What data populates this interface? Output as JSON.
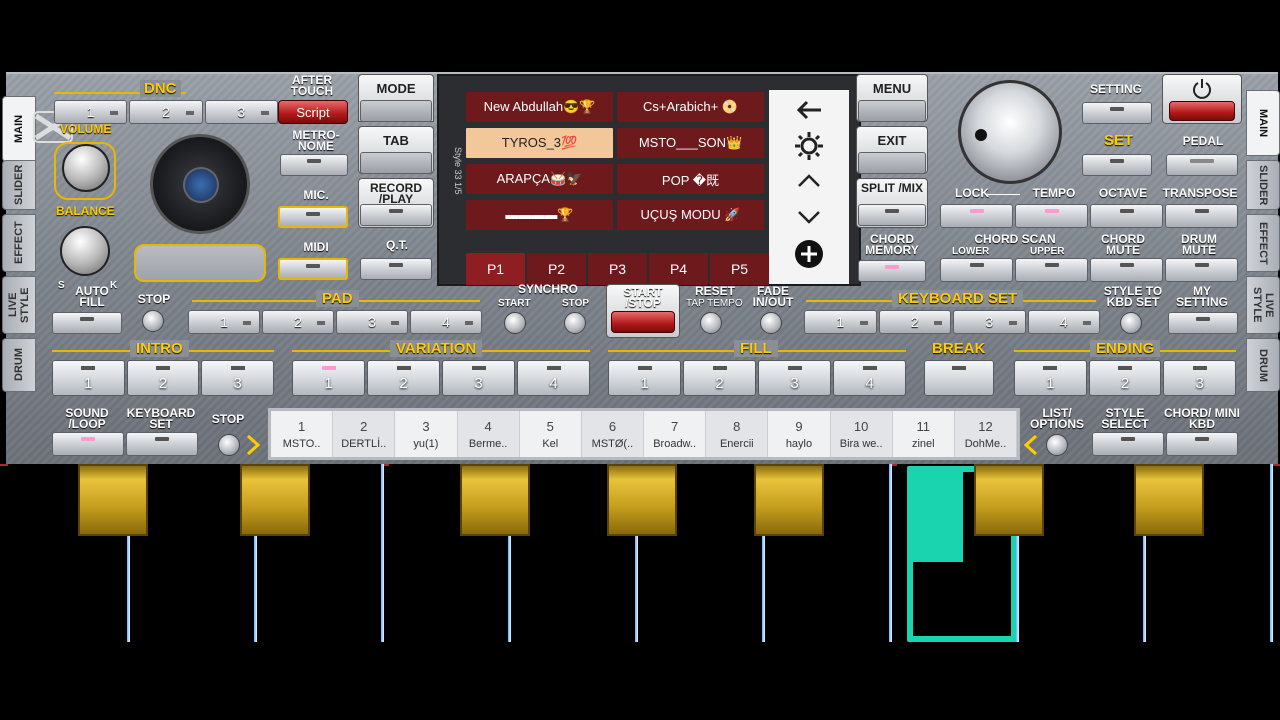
{
  "side_left": [
    "MAIN",
    "SLIDER",
    "EFFECT",
    "LIVE STYLE",
    "DRUM"
  ],
  "side_right": [
    "MAIN",
    "SLIDER",
    "EFFECT",
    "LIVE STYLE",
    "DRUM"
  ],
  "dnc": {
    "label": "DNC",
    "buttons": [
      "1",
      "2",
      "3"
    ],
    "script": "Script"
  },
  "after_touch": "AFTER TOUCH",
  "volume": "VOLUME",
  "balance": "BALANCE",
  "metronome": "METRO- NOME",
  "mic": "MIC.",
  "midi": "MIDI",
  "mode": "MODE",
  "tab": "TAB",
  "record_play": "RECORD /PLAY",
  "qt": "Q.T.",
  "menu": "MENU",
  "exit": "EXIT",
  "split_mix": "SPLIT /MIX",
  "chord_memory": "CHORD MEMORY",
  "setting": "SETTING",
  "set": "SET",
  "pedal": "PEDAL",
  "lock": "LOCK",
  "tempo": "TEMPO",
  "octave": "OCTAVE",
  "transpose": "TRANSPOSE",
  "chord_scan": "CHORD SCAN",
  "lower": "LOWER",
  "upper": "UPPER",
  "chord_mute": "CHORD MUTE",
  "drum_mute": "DRUM MUTE",
  "screen": {
    "side_label": "Style 33 1/5",
    "songs": [
      "New Abdullah😎🏆",
      "Cs+Arabich+ 📀",
      "TYROS_3💯",
      "MSTO___SON👑",
      "ARAPÇA🥁🦅",
      "POP �既",
      "▬▬▬▬🏆",
      "UÇUŞ MODU 🚀"
    ],
    "pages": [
      "P1",
      "P2",
      "P3",
      "P4",
      "P5"
    ]
  },
  "auto_fill": "AUTO FILL",
  "stop": "STOP",
  "pad": {
    "label": "PAD",
    "buttons": [
      "1",
      "2",
      "3",
      "4"
    ]
  },
  "synchro": "SYNCHRO",
  "synchro_start": "START",
  "synchro_stop": "STOP",
  "start_stop": "START /STOP",
  "reset": "RESET",
  "tap_tempo": "TAP TEMPO",
  "fade": "FADE IN/OUT",
  "keyboard_set": {
    "label": "KEYBOARD SET",
    "buttons": [
      "1",
      "2",
      "3",
      "4"
    ]
  },
  "style_to_kbd": "STYLE TO KBD SET",
  "my_setting": "MY SETTING",
  "intro": {
    "label": "INTRO",
    "buttons": [
      "1",
      "2",
      "3"
    ]
  },
  "variation": {
    "label": "VARIATION",
    "buttons": [
      "1",
      "2",
      "3",
      "4"
    ]
  },
  "fill": {
    "label": "FILL",
    "buttons": [
      "1",
      "2",
      "3",
      "4"
    ]
  },
  "break": "BREAK",
  "ending": {
    "label": "ENDING",
    "buttons": [
      "1",
      "2",
      "3"
    ]
  },
  "sound_loop": "SOUND /LOOP",
  "keyboard_set_small": "KEYBOARD SET",
  "stop_small": "STOP",
  "registrations": [
    {
      "n": "1",
      "name": "MSTO.."
    },
    {
      "n": "2",
      "name": "DERTLİ.."
    },
    {
      "n": "3",
      "name": "yu(1)"
    },
    {
      "n": "4",
      "name": "Berme.."
    },
    {
      "n": "5",
      "name": "Kel"
    },
    {
      "n": "6",
      "name": "MSTØ(.."
    },
    {
      "n": "7",
      "name": "Broadw.."
    },
    {
      "n": "8",
      "name": "Enercii"
    },
    {
      "n": "9",
      "name": "haylo"
    },
    {
      "n": "10",
      "name": "Bira we.."
    },
    {
      "n": "11",
      "name": "zinel"
    },
    {
      "n": "12",
      "name": "DohMe.."
    }
  ],
  "list_options": "LIST/ OPTIONS",
  "style_select": "STYLE SELECT",
  "chord_mini_kbd": "CHORD/ MINI KBD"
}
